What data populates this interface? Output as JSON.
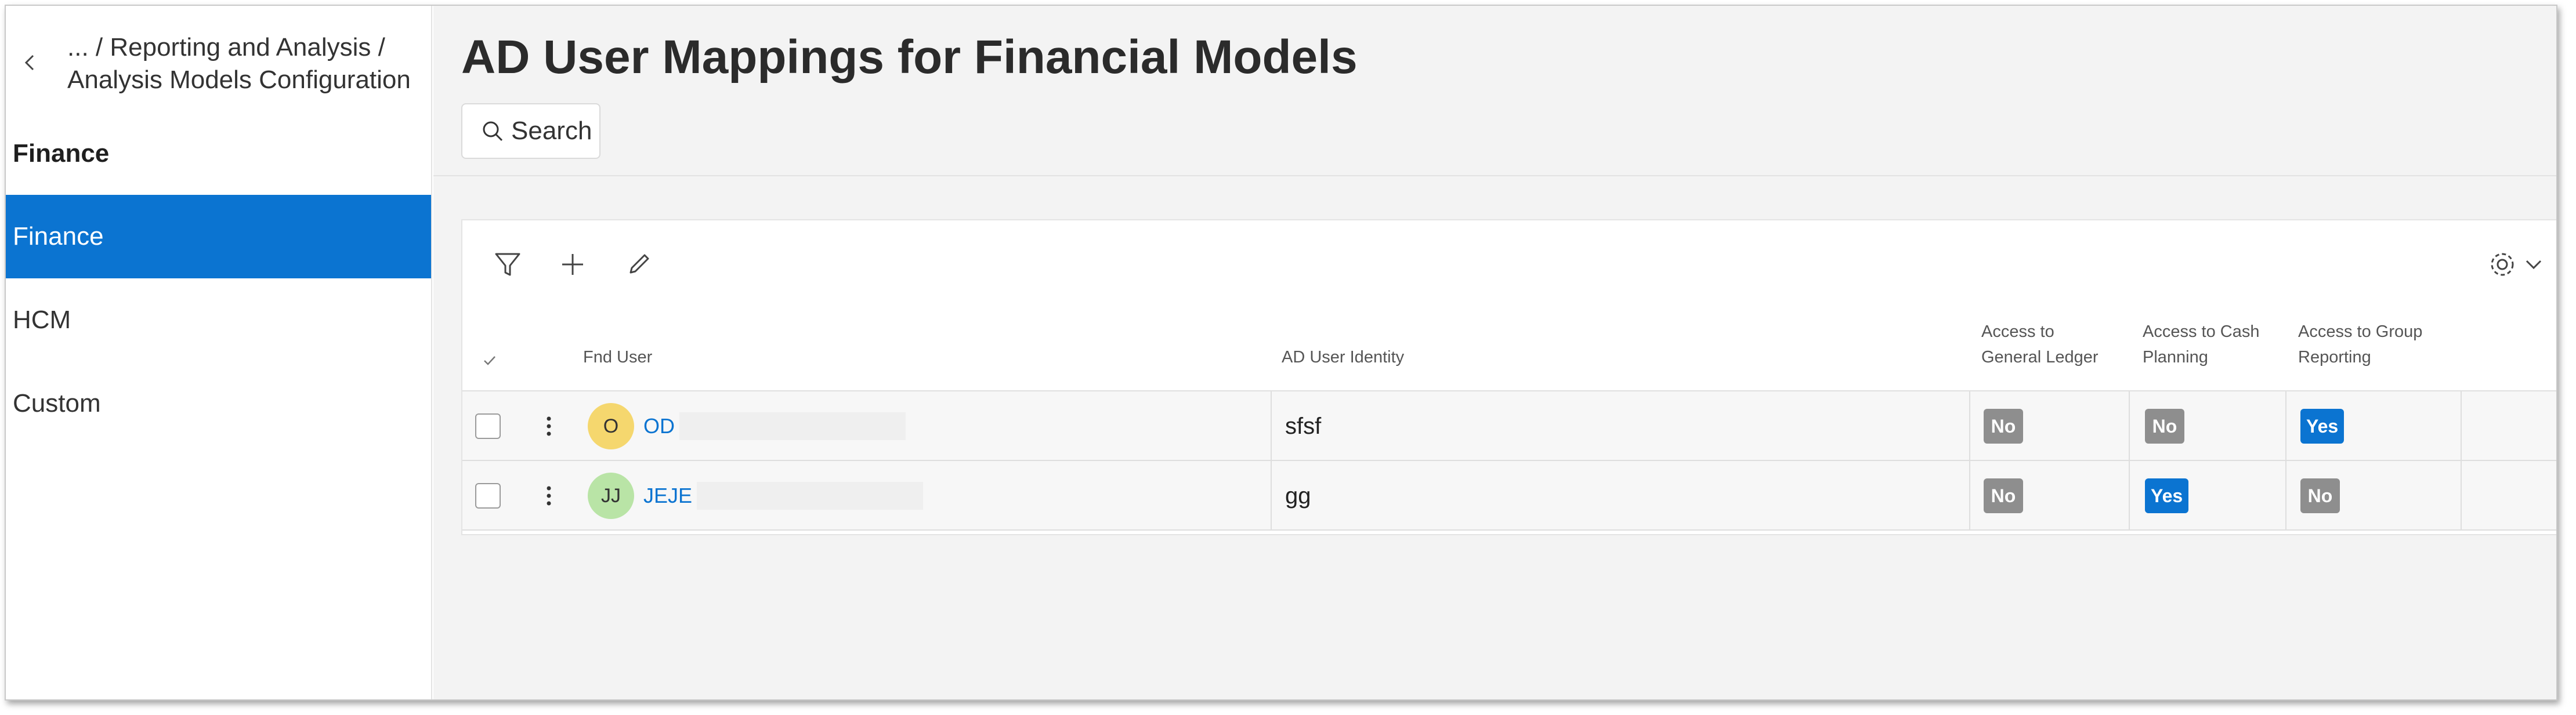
{
  "sidebar": {
    "breadcrumb_line1": "... / Reporting and Analysis /",
    "breadcrumb_line2": "Analysis Models Configuration",
    "section_title": "Finance",
    "items": [
      {
        "label": "Finance",
        "active": true
      },
      {
        "label": "HCM",
        "active": false
      },
      {
        "label": "Custom",
        "active": false
      }
    ]
  },
  "main": {
    "title": "AD User Mappings for Financial Models",
    "search_label": "Search"
  },
  "table": {
    "columns": {
      "fnd_user": "Fnd User",
      "ad_identity": "AD User Identity",
      "gl_line1": "Access to",
      "gl_line2": "General Ledger",
      "cash_line1": "Access to Cash",
      "cash_line2": "Planning",
      "group_line1": "Access to Group",
      "group_line2": "Reporting"
    },
    "rows": [
      {
        "avatar_initials": "O",
        "avatar_color": "#f5d76e",
        "user": "OD",
        "identity": "sfsf",
        "gl": "No",
        "cash": "No",
        "group": "Yes"
      },
      {
        "avatar_initials": "JJ",
        "avatar_color": "#b9e4a6",
        "user": "JEJE",
        "identity": "gg",
        "gl": "No",
        "cash": "Yes",
        "group": "No"
      }
    ]
  },
  "colors": {
    "accent": "#0b74d1",
    "badge_no": "#8e8e8e"
  },
  "icons": [
    "chevron-left-icon",
    "search-icon",
    "filter-icon",
    "plus-icon",
    "edit-icon",
    "gear-icon",
    "chevron-down-icon",
    "kebab-icon"
  ]
}
